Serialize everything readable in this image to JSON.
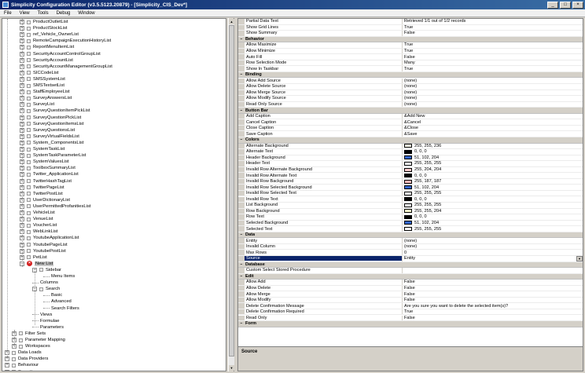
{
  "window": {
    "title": "Simplicity Configuration Editor (v3.5.5123.20879) - [Simplicity_CIS_Dev*]",
    "minimize": "_",
    "maximize": "□",
    "close": "×"
  },
  "menu": [
    "File",
    "View",
    "Tools",
    "Debug",
    "Window"
  ],
  "tree": {
    "items": [
      {
        "label": "ProductOutletList",
        "depth": 1,
        "exp": "+"
      },
      {
        "label": "ProductStockList",
        "depth": 1,
        "exp": "+"
      },
      {
        "label": "ref_Vehicle_OwnerList",
        "depth": 1,
        "exp": "+"
      },
      {
        "label": "RemoteCampaignExecutionHistoryList",
        "depth": 1,
        "exp": "+"
      },
      {
        "label": "ReportMenuItemList",
        "depth": 1,
        "exp": "+"
      },
      {
        "label": "SecurityAccountControlGroupList",
        "depth": 1,
        "exp": "+"
      },
      {
        "label": "SecurityAccountList",
        "depth": 1,
        "exp": "+"
      },
      {
        "label": "SecurityAccountManagementGroupList",
        "depth": 1,
        "exp": "+"
      },
      {
        "label": "SICCodeList",
        "depth": 1,
        "exp": "+"
      },
      {
        "label": "SMSSystemList",
        "depth": 1,
        "exp": "+"
      },
      {
        "label": "SMSTextsetList",
        "depth": 1,
        "exp": "+"
      },
      {
        "label": "StaffEmployeeList",
        "depth": 1,
        "exp": "+"
      },
      {
        "label": "SurveyAnswersList",
        "depth": 1,
        "exp": "+"
      },
      {
        "label": "SurveyList",
        "depth": 1,
        "exp": "+"
      },
      {
        "label": "SurveyQuestionItemPickList",
        "depth": 1,
        "exp": "+"
      },
      {
        "label": "SurveyQuestionPickList",
        "depth": 1,
        "exp": "+"
      },
      {
        "label": "SurveyQuestionItemsList",
        "depth": 1,
        "exp": "+"
      },
      {
        "label": "SurveyQuestionsList",
        "depth": 1,
        "exp": "+"
      },
      {
        "label": "SurveyVirtualFieldsList",
        "depth": 1,
        "exp": "+"
      },
      {
        "label": "System_ComponentsList",
        "depth": 1,
        "exp": "+"
      },
      {
        "label": "SystemTaskList",
        "depth": 1,
        "exp": "+"
      },
      {
        "label": "SystemTaskParameterList",
        "depth": 1,
        "exp": "+"
      },
      {
        "label": "SystemValuesList",
        "depth": 1,
        "exp": "+"
      },
      {
        "label": "ToolboxSummaryList",
        "depth": 1,
        "exp": "+"
      },
      {
        "label": "Twitter_ApplicationList",
        "depth": 1,
        "exp": "+"
      },
      {
        "label": "TwitterHashTagList",
        "depth": 1,
        "exp": "+"
      },
      {
        "label": "TwitterPageList",
        "depth": 1,
        "exp": "+"
      },
      {
        "label": "TwitterPostList",
        "depth": 1,
        "exp": "+"
      },
      {
        "label": "UserDictionaryList",
        "depth": 1,
        "exp": "+"
      },
      {
        "label": "UserPermittedProfanitiesList",
        "depth": 1,
        "exp": "+"
      },
      {
        "label": "VehicleList",
        "depth": 1,
        "exp": "+"
      },
      {
        "label": "VenueList",
        "depth": 1,
        "exp": "+"
      },
      {
        "label": "VoucherList",
        "depth": 1,
        "exp": "+"
      },
      {
        "label": "WebLinkList",
        "depth": 1,
        "exp": "+"
      },
      {
        "label": "YoutubeApplicationList",
        "depth": 1,
        "exp": "+"
      },
      {
        "label": "YoutubePageList",
        "depth": 1,
        "exp": "+"
      },
      {
        "label": "YoutubePostList",
        "depth": 1,
        "exp": "+"
      },
      {
        "label": "PetList",
        "depth": 1,
        "exp": "+"
      },
      {
        "label": "New List",
        "depth": 1,
        "exp": "−",
        "error": true,
        "selected": true
      },
      {
        "label": "Sidebar",
        "depth": 2,
        "exp": "−"
      },
      {
        "label": "Menu Items",
        "depth": 3,
        "exp": ""
      },
      {
        "label": "Columns",
        "depth": 2,
        "exp": ""
      },
      {
        "label": "Search",
        "depth": 2,
        "exp": "−"
      },
      {
        "label": "Basic",
        "depth": 3,
        "exp": ""
      },
      {
        "label": "Advanced",
        "depth": 3,
        "exp": ""
      },
      {
        "label": "Search Filters",
        "depth": 3,
        "exp": ""
      },
      {
        "label": "Views",
        "depth": 2,
        "exp": ""
      },
      {
        "label": "Formulae",
        "depth": 2,
        "exp": ""
      },
      {
        "label": "Parameters",
        "depth": 2,
        "exp": ""
      },
      {
        "label": "Filter Sets",
        "depth": 0.5,
        "exp": "+"
      },
      {
        "label": "Parameter Mapping",
        "depth": 0.5,
        "exp": "+"
      },
      {
        "label": "Workspaces",
        "depth": 0.5,
        "exp": "+"
      },
      {
        "label": "Data Loads",
        "depth": 0,
        "exp": "+"
      },
      {
        "label": "Data Providers",
        "depth": 0,
        "exp": "+"
      },
      {
        "label": "Behaviour",
        "depth": 0,
        "exp": "+"
      },
      {
        "label": "Security",
        "depth": 0,
        "exp": "+"
      }
    ]
  },
  "properties": [
    {
      "name": "Partial Data Text",
      "value": "Retrieved 1/1 out of 1/2 records"
    },
    {
      "name": "Show Grid Lines",
      "value": "True"
    },
    {
      "name": "Show Summary",
      "value": "False"
    },
    {
      "cat": "Behavior"
    },
    {
      "name": "Allow Maximize",
      "value": "True"
    },
    {
      "name": "Allow Minimize",
      "value": "True"
    },
    {
      "name": "Auto Fill",
      "value": "False"
    },
    {
      "name": "Row Selection Mode",
      "value": "Many"
    },
    {
      "name": "Show In Taskbar",
      "value": "True"
    },
    {
      "cat": "Binding"
    },
    {
      "name": "Allow Add Source",
      "value": "(none)"
    },
    {
      "name": "Allow Delete Source",
      "value": "(none)"
    },
    {
      "name": "Allow Merge Source",
      "value": "(none)"
    },
    {
      "name": "Allow Modify Source",
      "value": "(none)"
    },
    {
      "name": "Read Only Source",
      "value": "(none)"
    },
    {
      "cat": "Button Bar"
    },
    {
      "name": "Add Caption",
      "value": "&Add New"
    },
    {
      "name": "Cancel Caption",
      "value": "&Cancel"
    },
    {
      "name": "Close Caption",
      "value": "&Close"
    },
    {
      "name": "Save Caption",
      "value": "&Save"
    },
    {
      "cat": "Colors"
    },
    {
      "name": "Alternate Background",
      "value": "255, 255, 236",
      "color": "#ffffec"
    },
    {
      "name": "Alternate Text",
      "value": "0, 0, 0",
      "color": "#000000"
    },
    {
      "name": "Header Background",
      "value": "51, 102, 204",
      "color": "#3366cc"
    },
    {
      "name": "Header Text",
      "value": "255, 255, 255",
      "color": "#ffffff"
    },
    {
      "name": "Invalid Row Alternate Background",
      "value": "255, 204, 204",
      "color": "#ffcccc"
    },
    {
      "name": "Invalid Row Alternate Text",
      "value": "0, 0, 0",
      "color": "#000000"
    },
    {
      "name": "Invalid Row Background",
      "value": "255, 187, 187",
      "color": "#ffbbbb"
    },
    {
      "name": "Invalid Row Selected Background",
      "value": "51, 102, 204",
      "color": "#3366cc"
    },
    {
      "name": "Invalid Row Selected Text",
      "value": "255, 255, 255",
      "color": "#ffffff"
    },
    {
      "name": "Invalid Row Text",
      "value": "0, 0, 0",
      "color": "#000000"
    },
    {
      "name": "List Background",
      "value": "255, 255, 255",
      "color": "#ffffff"
    },
    {
      "name": "Row Background",
      "value": "255, 255, 204",
      "color": "#ffffcc"
    },
    {
      "name": "Row Text",
      "value": "0, 0, 0",
      "color": "#000000"
    },
    {
      "name": "Selected Background",
      "value": "51, 102, 204",
      "color": "#3366cc"
    },
    {
      "name": "Selected Text",
      "value": "255, 255, 255",
      "color": "#ffffff"
    },
    {
      "cat": "Data"
    },
    {
      "name": "Entity",
      "value": "(none)"
    },
    {
      "name": "Invalid Column",
      "value": "(none)"
    },
    {
      "name": "Max Rows",
      "value": "0"
    },
    {
      "name": "Source",
      "value": "Entity",
      "selected": true,
      "dropdown": true
    },
    {
      "cat": "Database"
    },
    {
      "name": "Custom Select Stored Procedure",
      "value": ""
    },
    {
      "cat": "Edit"
    },
    {
      "name": "Allow Add",
      "value": "False"
    },
    {
      "name": "Allow Delete",
      "value": "False"
    },
    {
      "name": "Allow Merge",
      "value": "False"
    },
    {
      "name": "Allow Modify",
      "value": "False"
    },
    {
      "name": "Delete Confirmation Message",
      "value": "Are you sure you want to delete the selected item(s)?"
    },
    {
      "name": "Delete Confirmation Required",
      "value": "True"
    },
    {
      "name": "Read Only",
      "value": "False"
    },
    {
      "cat": "Form"
    }
  ],
  "description": {
    "title": "Source"
  }
}
